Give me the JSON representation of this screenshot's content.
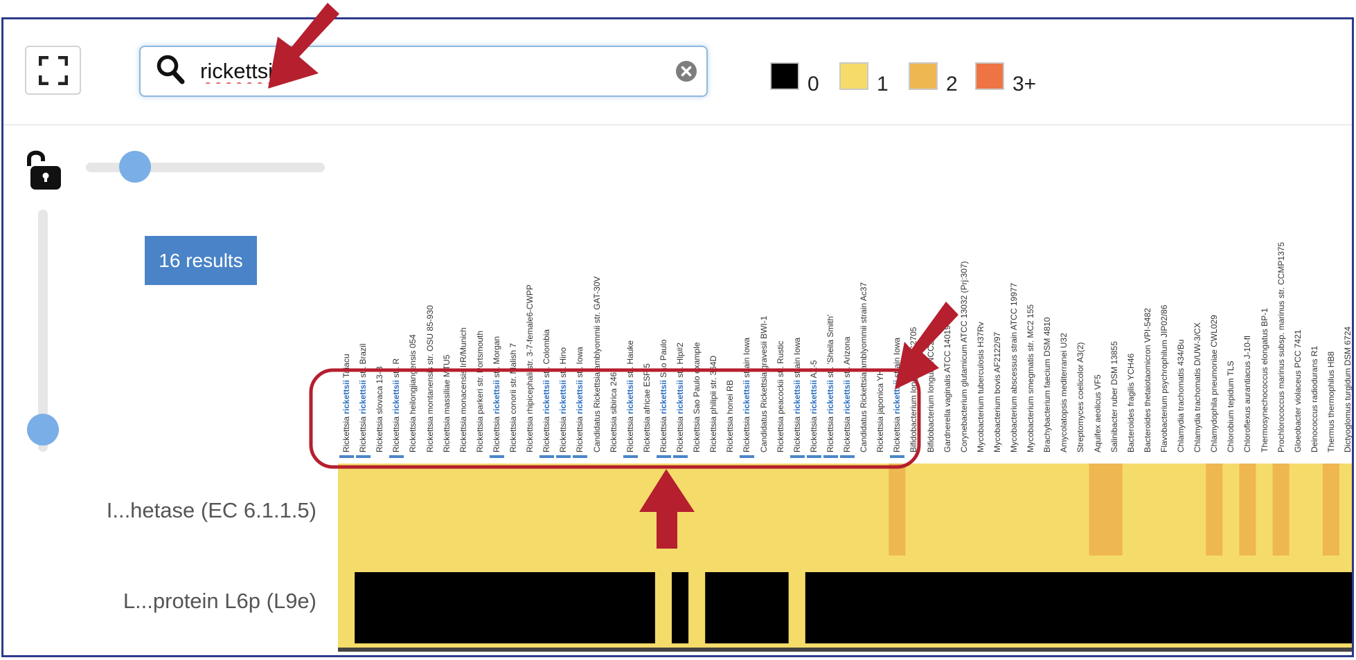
{
  "search": {
    "query": "rickettsii",
    "clear_icon": "clear-circle-icon",
    "search_icon": "magnifier-icon"
  },
  "toolbar": {
    "fullscreen_icon": "expand-corners-icon",
    "lock_icon": "unlocked-padlock-icon"
  },
  "legend": [
    {
      "label": "0",
      "color": "#000000"
    },
    {
      "label": "1",
      "color": "#f5dc6a"
    },
    {
      "label": "2",
      "color": "#eeb752"
    },
    {
      "label": "3+",
      "color": "#ee7443"
    }
  ],
  "results": {
    "label": "16 results"
  },
  "rows": [
    {
      "label": "I...hetase (EC 6.1.1.5)"
    },
    {
      "label": "L...protein L6p (L9e)"
    }
  ],
  "highlight_term": "rickettsii",
  "columns": [
    {
      "label": "Rickettsia rickettsii Taiacu",
      "match": true,
      "r1": 1,
      "r2": 1
    },
    {
      "label": "Rickettsia rickettsii str. Brazil",
      "match": true,
      "r1": 1,
      "r2": 0
    },
    {
      "label": "Rickettsia slovaca 13-B",
      "match": false,
      "r1": 1,
      "r2": 0
    },
    {
      "label": "Rickettsia rickettsii str. R",
      "match": true,
      "r1": 1,
      "r2": 0
    },
    {
      "label": "Rickettsia heilongjiangensis 054",
      "match": false,
      "r1": 1,
      "r2": 0
    },
    {
      "label": "Rickettsia montanensis str. OSU 85-930",
      "match": false,
      "r1": 1,
      "r2": 0
    },
    {
      "label": "Rickettsia massiliae MTU5",
      "match": false,
      "r1": 1,
      "r2": 0
    },
    {
      "label": "Rickettsia monacensis IrR/Munich",
      "match": false,
      "r1": 1,
      "r2": 0
    },
    {
      "label": "Rickettsia parkeri str. Portsmouth",
      "match": false,
      "r1": 1,
      "r2": 0
    },
    {
      "label": "Rickettsia rickettsii str. Morgan",
      "match": true,
      "r1": 1,
      "r2": 0
    },
    {
      "label": "Rickettsia conorii str. Malish 7",
      "match": false,
      "r1": 1,
      "r2": 0
    },
    {
      "label": "Rickettsia rhipicephali str. 3-7-female6-CWPP",
      "match": false,
      "r1": 1,
      "r2": 0
    },
    {
      "label": "Rickettsia rickettsii str. Colombia",
      "match": true,
      "r1": 1,
      "r2": 0
    },
    {
      "label": "Rickettsia rickettsii str. Hino",
      "match": true,
      "r1": 1,
      "r2": 0
    },
    {
      "label": "Rickettsia rickettsii str. Iowa",
      "match": true,
      "r1": 1,
      "r2": 0
    },
    {
      "label": "Candidatus Rickettsia amblyommii str. GAT-30V",
      "match": false,
      "r1": 1,
      "r2": 0
    },
    {
      "label": "Rickettsia sibirica 246",
      "match": false,
      "r1": 1,
      "r2": 0
    },
    {
      "label": "Rickettsia rickettsii str. Hauke",
      "match": true,
      "r1": 1,
      "r2": 0
    },
    {
      "label": "Rickettsia africae ESF-5",
      "match": false,
      "r1": 1,
      "r2": 0
    },
    {
      "label": "Rickettsia rickettsii Sao Paulo",
      "match": true,
      "r1": 1,
      "r2": 1
    },
    {
      "label": "Rickettsia rickettsii str. Hlp#2",
      "match": true,
      "r1": 1,
      "r2": 0
    },
    {
      "label": "Rickettsia Sao Paulo example",
      "match": false,
      "r1": 1,
      "r2": 1
    },
    {
      "label": "Rickettsia philipii str. 364D",
      "match": false,
      "r1": 1,
      "r2": 0
    },
    {
      "label": "Rickettsia honei RB",
      "match": false,
      "r1": 1,
      "r2": 0
    },
    {
      "label": "Rickettsia rickettsii strain Iowa",
      "match": true,
      "r1": 1,
      "r2": 0
    },
    {
      "label": "Candidatus Rickettsia gravesii BWI-1",
      "match": false,
      "r1": 1,
      "r2": 0
    },
    {
      "label": "Rickettsia peacockii str. Rustic",
      "match": false,
      "r1": 1,
      "r2": 0
    },
    {
      "label": "Rickettsia rickettsii strain Iowa",
      "match": true,
      "r1": 1,
      "r2": 1
    },
    {
      "label": "Rickettsia rickettsii AZ-5",
      "match": true,
      "r1": 1,
      "r2": 0
    },
    {
      "label": "Rickettsia rickettsii str. 'Sheila Smith'",
      "match": true,
      "r1": 1,
      "r2": 0
    },
    {
      "label": "Rickettsia rickettsii str. Arizona",
      "match": true,
      "r1": 1,
      "r2": 0
    },
    {
      "label": "Candidatus Rickettsia amblyommii strain Ac37",
      "match": false,
      "r1": 1,
      "r2": 0
    },
    {
      "label": "Rickettsia japonica YH",
      "match": false,
      "r1": 1,
      "r2": 0
    },
    {
      "label": "Rickettsia rickettsii strain Iowa",
      "match": true,
      "r1": 2,
      "r2": 0
    },
    {
      "label": "Bifidobacterium longum NCC2705",
      "match": false,
      "r1": 1,
      "r2": 0
    },
    {
      "label": "Bifidobacterium longum NCC2705",
      "match": false,
      "r1": 1,
      "r2": 0
    },
    {
      "label": "Gardnerella vaginalis ATCC 14019",
      "match": false,
      "r1": 1,
      "r2": 0
    },
    {
      "label": "Corynebacterium glutamicum ATCC 13032 (Prj:307)",
      "match": false,
      "r1": 1,
      "r2": 0
    },
    {
      "label": "Mycobacterium tuberculosis H37Rv",
      "match": false,
      "r1": 1,
      "r2": 0
    },
    {
      "label": "Mycobacterium bovis AF2122/97",
      "match": false,
      "r1": 1,
      "r2": 0
    },
    {
      "label": "Mycobacterium abscessus strain ATCC 19977",
      "match": false,
      "r1": 1,
      "r2": 0
    },
    {
      "label": "Mycobacterium smegmatis str. MC2 155",
      "match": false,
      "r1": 1,
      "r2": 0
    },
    {
      "label": "Brachybacterium faecium DSM 4810",
      "match": false,
      "r1": 1,
      "r2": 0
    },
    {
      "label": "Amycolatopsis mediterranei U32",
      "match": false,
      "r1": 1,
      "r2": 0
    },
    {
      "label": "Streptomyces coelicolor A3(2)",
      "match": false,
      "r1": 1,
      "r2": 0
    },
    {
      "label": "Aquifex aeolicus VF5",
      "match": false,
      "r1": 2,
      "r2": 0
    },
    {
      "label": "Salinibacter ruber DSM 13855",
      "match": false,
      "r1": 2,
      "r2": 0
    },
    {
      "label": "Bacteroides fragilis YCH46",
      "match": false,
      "r1": 1,
      "r2": 0
    },
    {
      "label": "Bacteroides thetaiotaomicron VPI-5482",
      "match": false,
      "r1": 1,
      "r2": 0
    },
    {
      "label": "Flavobacterium psychrophilum JIP02/86",
      "match": false,
      "r1": 1,
      "r2": 0
    },
    {
      "label": "Chlamydia trachomatis 434/Bu",
      "match": false,
      "r1": 1,
      "r2": 0
    },
    {
      "label": "Chlamydia trachomatis D/UW-3/CX",
      "match": false,
      "r1": 1,
      "r2": 0
    },
    {
      "label": "Chlamydophila pneumoniae CWL029",
      "match": false,
      "r1": 2,
      "r2": 0
    },
    {
      "label": "Chlorobium tepidum TLS",
      "match": false,
      "r1": 1,
      "r2": 0
    },
    {
      "label": "Chloroflexus aurantiacus J-10-fl",
      "match": false,
      "r1": 2,
      "r2": 0
    },
    {
      "label": "Thermosynechococcus elongatus BP-1",
      "match": false,
      "r1": 1,
      "r2": 0
    },
    {
      "label": "Prochlorococcus marinus subsp. marinus str. CCMP1375",
      "match": false,
      "r1": 2,
      "r2": 0
    },
    {
      "label": "Gloeobacter violaceus PCC 7421",
      "match": false,
      "r1": 1,
      "r2": 0
    },
    {
      "label": "Deinococcus radiodurans R1",
      "match": false,
      "r1": 1,
      "r2": 0
    },
    {
      "label": "Thermus thermophilus HB8",
      "match": false,
      "r1": 2,
      "r2": 0
    },
    {
      "label": "Dictyoglomus turgidum DSM 6724",
      "match": false,
      "r1": 1,
      "r2": 0
    }
  ]
}
